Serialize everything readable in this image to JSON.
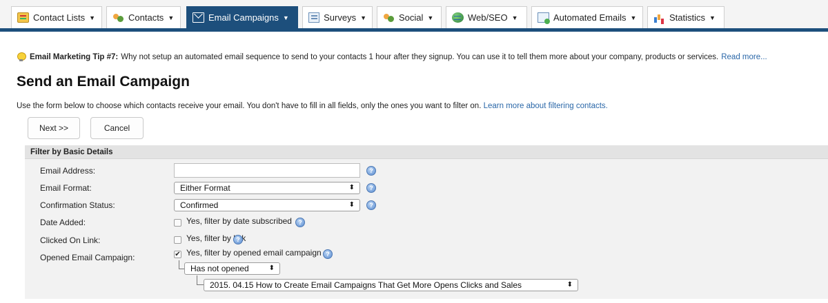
{
  "nav": {
    "tabs": [
      {
        "label": "Contact Lists",
        "icon": "notebook-icon"
      },
      {
        "label": "Contacts",
        "icon": "contacts-icon"
      },
      {
        "label": "Email Campaigns",
        "icon": "mail-icon",
        "active": true
      },
      {
        "label": "Surveys",
        "icon": "form-icon"
      },
      {
        "label": "Social",
        "icon": "social-icon"
      },
      {
        "label": "Web/SEO",
        "icon": "globe-icon"
      },
      {
        "label": "Automated Emails",
        "icon": "automated-mail-icon"
      },
      {
        "label": "Statistics",
        "icon": "bar-chart-icon"
      }
    ],
    "caret": "▼",
    "accent": "#1d4f7c"
  },
  "tip": {
    "title": "Email Marketing Tip #7:",
    "text": "Why not setup an automated email sequence to send to your contacts 1 hour after they signup. You can use it to tell them more about your company, products or services.",
    "link": "Read more..."
  },
  "page": {
    "title": "Send an Email Campaign",
    "description": "Use the form below to choose which contacts receive your email. You don't have to fill in all fields, only the ones you want to filter on.",
    "description_link": "Learn more about filtering contacts."
  },
  "buttons": {
    "next": "Next >>",
    "cancel": "Cancel"
  },
  "filter": {
    "section_title": "Filter by Basic Details",
    "email_address": {
      "label": "Email Address:",
      "value": ""
    },
    "email_format": {
      "label": "Email Format:",
      "value": "Either Format"
    },
    "confirmation_status": {
      "label": "Confirmation Status:",
      "value": "Confirmed"
    },
    "date_added": {
      "label": "Date Added:",
      "checkbox_text": "Yes, filter by date subscribed",
      "checked": false
    },
    "clicked_link": {
      "label": "Clicked On Link:",
      "checkbox_text": "Yes, filter by link",
      "checked": false
    },
    "opened_campaign": {
      "label": "Opened Email Campaign:",
      "checkbox_text": "Yes, filter by opened email campaign",
      "checked": true,
      "open_state": "Has not opened",
      "campaign": "2015. 04.15 How to Create Email Campaigns That Get More Opens Clicks and Sales"
    },
    "select_arrow": "⬍",
    "check_mark": "✔",
    "help_glyph": "?"
  }
}
